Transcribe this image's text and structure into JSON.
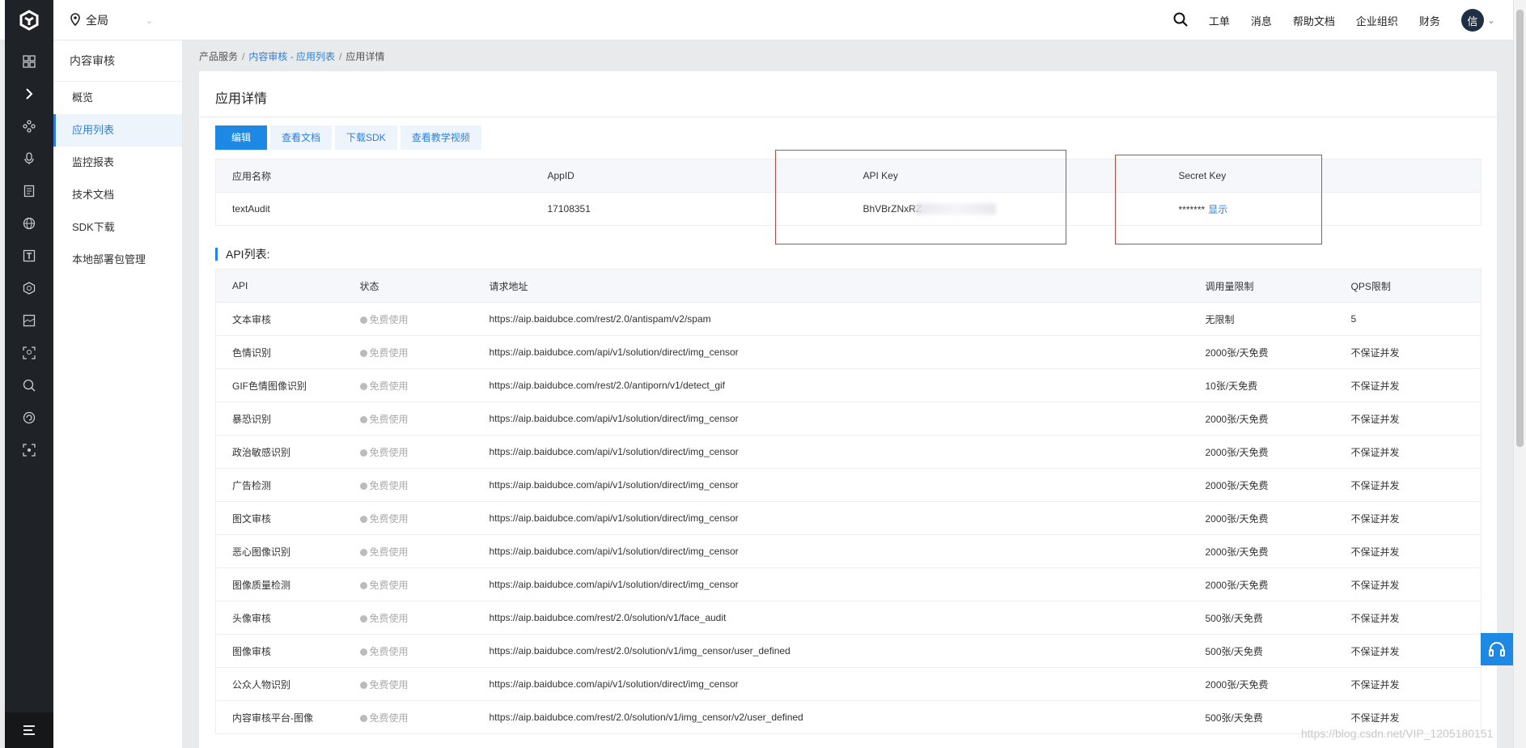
{
  "topbar": {
    "region_label": "全局",
    "nav": [
      "工单",
      "消息",
      "帮助文档",
      "企业组织",
      "财务"
    ],
    "avatar_text": "信"
  },
  "sidebar": {
    "title": "内容审核",
    "items": [
      {
        "label": "概览",
        "active": false
      },
      {
        "label": "应用列表",
        "active": true
      },
      {
        "label": "监控报表",
        "active": false
      },
      {
        "label": "技术文档",
        "active": false
      },
      {
        "label": "SDK下载",
        "active": false
      },
      {
        "label": "本地部署包管理",
        "active": false
      }
    ]
  },
  "breadcrumb": {
    "root": "产品服务",
    "link": "内容审核 - 应用列表",
    "current": "应用详情"
  },
  "panel": {
    "title": "应用详情",
    "buttons": [
      "编辑",
      "查看文档",
      "下载SDK",
      "查看教学视频"
    ]
  },
  "app_table": {
    "headers": [
      "应用名称",
      "AppID",
      "API Key",
      "Secret Key"
    ],
    "row": {
      "name": "textAudit",
      "appid": "17108351",
      "api_key_visible": "BhVBrZNxRZ",
      "secret_masked": "*******",
      "show_label": "显示"
    }
  },
  "api_list": {
    "title": "API列表:",
    "headers": [
      "API",
      "状态",
      "请求地址",
      "调用量限制",
      "QPS限制"
    ],
    "rows": [
      {
        "api": "文本审核",
        "status": "免费使用",
        "url": "https://aip.baidubce.com/rest/2.0/antispam/v2/spam",
        "limit": "无限制",
        "qps": "5"
      },
      {
        "api": "色情识别",
        "status": "免费使用",
        "url": "https://aip.baidubce.com/api/v1/solution/direct/img_censor",
        "limit": "2000张/天免费",
        "qps": "不保证并发"
      },
      {
        "api": "GIF色情图像识别",
        "status": "免费使用",
        "url": "https://aip.baidubce.com/rest/2.0/antiporn/v1/detect_gif",
        "limit": "10张/天免费",
        "qps": "不保证并发"
      },
      {
        "api": "暴恐识别",
        "status": "免费使用",
        "url": "https://aip.baidubce.com/api/v1/solution/direct/img_censor",
        "limit": "2000张/天免费",
        "qps": "不保证并发"
      },
      {
        "api": "政治敏感识别",
        "status": "免费使用",
        "url": "https://aip.baidubce.com/api/v1/solution/direct/img_censor",
        "limit": "2000张/天免费",
        "qps": "不保证并发"
      },
      {
        "api": "广告检测",
        "status": "免费使用",
        "url": "https://aip.baidubce.com/api/v1/solution/direct/img_censor",
        "limit": "2000张/天免费",
        "qps": "不保证并发"
      },
      {
        "api": "图文审核",
        "status": "免费使用",
        "url": "https://aip.baidubce.com/api/v1/solution/direct/img_censor",
        "limit": "2000张/天免费",
        "qps": "不保证并发"
      },
      {
        "api": "恶心图像识别",
        "status": "免费使用",
        "url": "https://aip.baidubce.com/api/v1/solution/direct/img_censor",
        "limit": "2000张/天免费",
        "qps": "不保证并发"
      },
      {
        "api": "图像质量检测",
        "status": "免费使用",
        "url": "https://aip.baidubce.com/api/v1/solution/direct/img_censor",
        "limit": "2000张/天免费",
        "qps": "不保证并发"
      },
      {
        "api": "头像审核",
        "status": "免费使用",
        "url": "https://aip.baidubce.com/rest/2.0/solution/v1/face_audit",
        "limit": "500张/天免费",
        "qps": "不保证并发"
      },
      {
        "api": "图像审核",
        "status": "免费使用",
        "url": "https://aip.baidubce.com/rest/2.0/solution/v1/img_censor/user_defined",
        "limit": "500张/天免费",
        "qps": "不保证并发"
      },
      {
        "api": "公众人物识别",
        "status": "免费使用",
        "url": "https://aip.baidubce.com/api/v1/solution/direct/img_censor",
        "limit": "2000张/天免费",
        "qps": "不保证并发"
      },
      {
        "api": "内容审核平台-图像",
        "status": "免费使用",
        "url": "https://aip.baidubce.com/rest/2.0/solution/v1/img_censor/v2/user_defined",
        "limit": "500张/天免费",
        "qps": "不保证并发"
      }
    ]
  },
  "watermark": "https://blog.csdn.net/VIP_1205180151",
  "colors": {
    "accent": "#1e88e5",
    "link": "#2d7ee0",
    "sidebar_dark": "#1f2328",
    "highlight_box": "#e53935"
  }
}
